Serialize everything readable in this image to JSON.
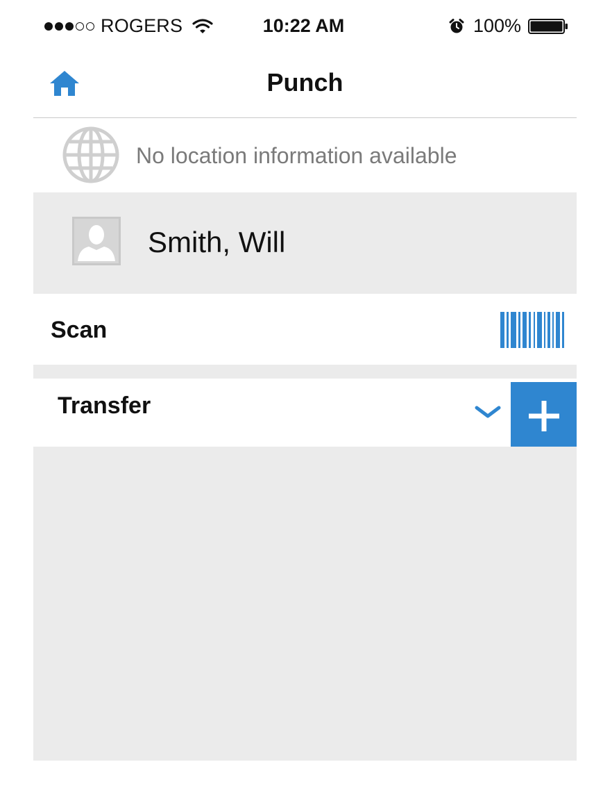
{
  "status_bar": {
    "carrier": "ROGERS",
    "signal_filled": 3,
    "signal_empty": 2,
    "time": "10:22 AM",
    "battery": "100%",
    "icons": [
      "wifi-icon",
      "alarm-icon",
      "battery-icon"
    ]
  },
  "nav": {
    "title": "Punch",
    "home_icon": "home-icon"
  },
  "location": {
    "icon": "globe-icon",
    "text": "No location information available"
  },
  "user": {
    "icon": "avatar-placeholder-icon",
    "name": "Smith, Will"
  },
  "scan": {
    "label": "Scan",
    "icon": "barcode-icon"
  },
  "transfer": {
    "label": "Transfer",
    "dropdown_icon": "chevron-down-icon",
    "add_icon": "plus-icon"
  },
  "colors": {
    "accent": "#2f86d0",
    "panel_gray": "#ebebeb",
    "muted_text": "#7a7a7a",
    "divider": "#c9c9c9"
  }
}
